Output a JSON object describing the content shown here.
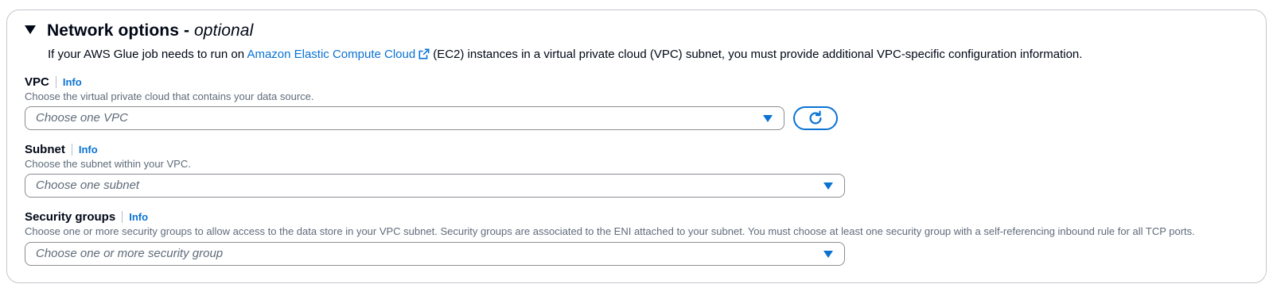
{
  "section": {
    "title": "Network options - ",
    "title_suffix": "optional",
    "description_prefix": "If your AWS Glue job needs to run on ",
    "description_link": "Amazon Elastic Compute Cloud",
    "description_suffix": "(EC2) instances in a virtual private cloud (VPC) subnet, you must provide additional VPC-specific configuration information."
  },
  "vpc": {
    "label": "VPC",
    "info": "Info",
    "hint": "Choose the virtual private cloud that contains your data source.",
    "placeholder": "Choose one VPC"
  },
  "subnet": {
    "label": "Subnet",
    "info": "Info",
    "hint": "Choose the subnet within your VPC.",
    "placeholder": "Choose one subnet"
  },
  "security_groups": {
    "label": "Security groups",
    "info": "Info",
    "hint": "Choose one or more security groups to allow access to the data store in your VPC subnet. Security groups are associated to the ENI attached to your subnet. You must choose at least one security group with a self-referencing inbound rule for all TCP ports.",
    "placeholder": "Choose one or more security group"
  },
  "icons": {
    "caret": "caret-down-icon",
    "external": "external-link-icon",
    "refresh": "refresh-icon",
    "dropdown": "dropdown-arrow-icon"
  },
  "colors": {
    "link": "#0972d3",
    "text": "#000716",
    "secondary": "#5f6b7a",
    "border": "#8c8c94"
  }
}
